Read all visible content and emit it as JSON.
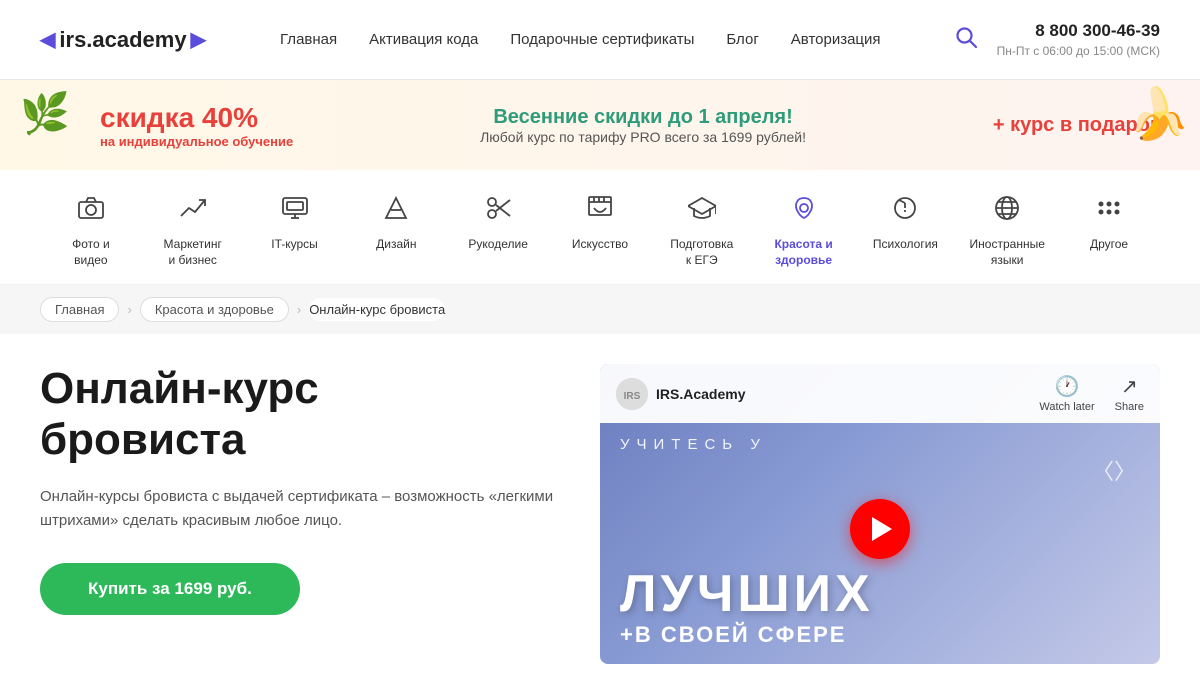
{
  "header": {
    "logo_text": "irs.academy",
    "nav_items": [
      "Главная",
      "Активация кода",
      "Подарочные сертификаты",
      "Блог",
      "Авторизация"
    ],
    "phone": "8 800 300-46-39",
    "phone_hours": "Пн-Пт с 06:00 до 15:00 (МСК)"
  },
  "banner": {
    "sale_percent": "скидка 40%",
    "sale_desc": "на индивидуальное обучение",
    "title": "Весенние скидки до 1 апреля!",
    "subtitle": "Любой курс по тарифу PRO всего за 1699 рублей!",
    "cta": "+ курс в подарок"
  },
  "categories": [
    {
      "label": "Фото и\nвидео",
      "icon": "📷",
      "active": false
    },
    {
      "label": "Маркетинг\nи бизнес",
      "icon": "📈",
      "active": false
    },
    {
      "label": "IT-курсы",
      "icon": "🖥",
      "active": false
    },
    {
      "label": "Дизайн",
      "icon": "⚖",
      "active": false
    },
    {
      "label": "Рукоделие",
      "icon": "✂",
      "active": false
    },
    {
      "label": "Искусство",
      "icon": "🎨",
      "active": false
    },
    {
      "label": "Подготовка\nк ЕГЭ",
      "icon": "🎓",
      "active": false
    },
    {
      "label": "Красота и\nздоровье",
      "icon": "💎",
      "active": true
    },
    {
      "label": "Психология",
      "icon": "💡",
      "active": false
    },
    {
      "label": "Иностранные\nязыки",
      "icon": "🌐",
      "active": false
    },
    {
      "label": "Другое",
      "icon": "⋯",
      "active": false
    }
  ],
  "breadcrumb": {
    "items": [
      "Главная",
      "Красота и здоровье",
      "Онлайн-курс бровиста"
    ]
  },
  "course": {
    "title": "Онлайн-курс\nбровиста",
    "description": "Онлайн-курсы бровиста с выдачей сертификата – возможность «легкими штрихами» сделать красивым любое лицо.",
    "buy_label": "Купить за 1699 руб."
  },
  "video": {
    "channel_name": "IRS.Academy",
    "watch_later": "Watch later",
    "share": "Share",
    "learn_text": "УЧИТЕСЬ У",
    "main_text": "ЛУЧШИХ",
    "sub_text": "+В СВОЕЙ СФЕРЕ"
  }
}
